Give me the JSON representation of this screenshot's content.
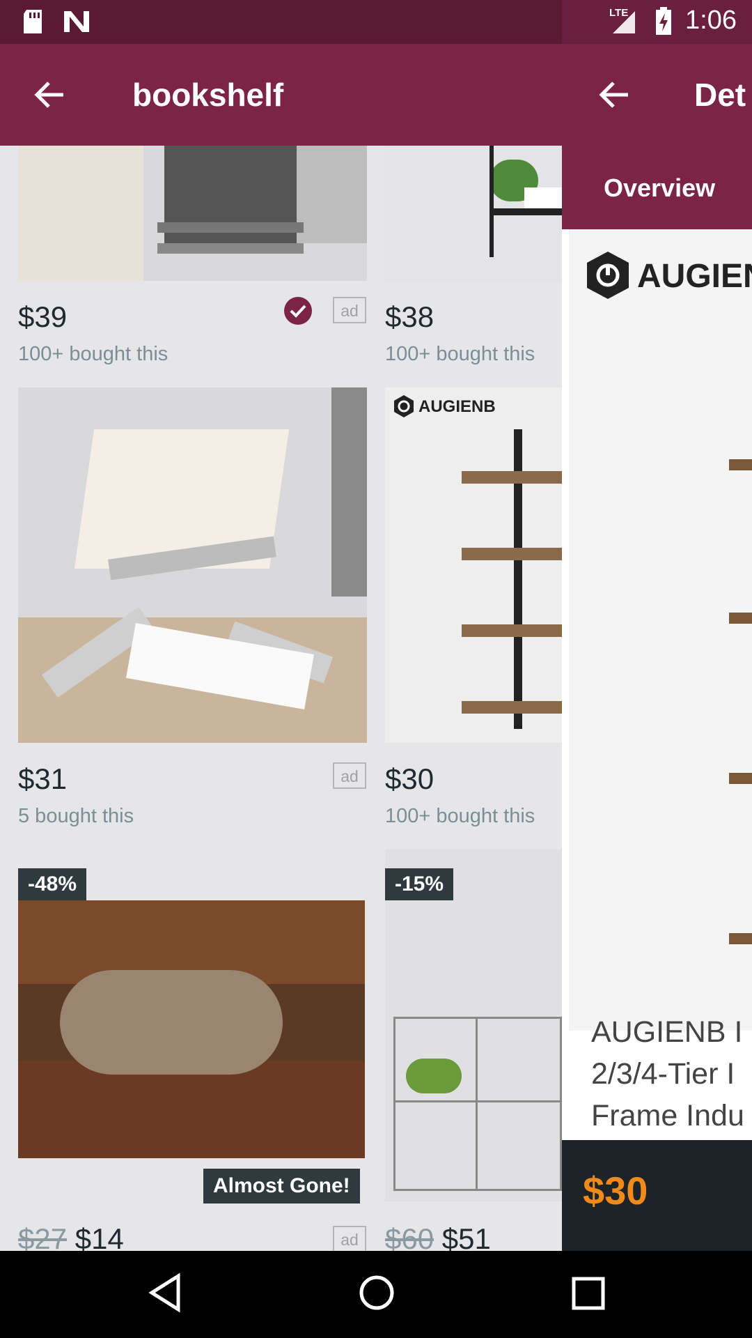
{
  "status": {
    "time": "1:06",
    "network": "LTE"
  },
  "header": {
    "title": "bookshelf"
  },
  "products": [
    {
      "price": "$39",
      "bought": "100+ bought this",
      "ad": "ad",
      "verified": true
    },
    {
      "price": "$38",
      "bought": "100+ bought this"
    },
    {
      "price": "$31",
      "bought": "5 bought this",
      "ad": "ad"
    },
    {
      "price": "$30",
      "bought": "100+ bought this",
      "brand": "AUGIENB"
    },
    {
      "discount": "-48%",
      "old_price": "$27",
      "price": "$14",
      "badge": "Almost Gone!",
      "ad": "ad"
    },
    {
      "discount": "-15%",
      "old_price": "$60",
      "price": "$51"
    }
  ],
  "detail": {
    "title": "Det",
    "tab": "Overview",
    "brand": "AUGIEN",
    "description_lines": [
      "AUGIENB I",
      "2/3/4-Tier I",
      "Frame Indu"
    ],
    "price": "$30"
  },
  "colors": {
    "primary": "#7b2446",
    "status": "#5a1a34",
    "price_accent": "#f08a1e"
  }
}
